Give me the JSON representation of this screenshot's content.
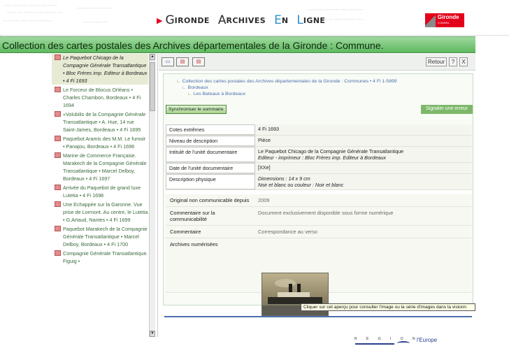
{
  "header": {
    "title_arrow": "▶",
    "title_words": [
      {
        "cap": "G",
        "rest": "IRONDE"
      },
      {
        "cap": "A",
        "rest": "RCHIVES"
      },
      {
        "cap": "E",
        "rest": "N"
      },
      {
        "cap": "L",
        "rest": "IGNE"
      }
    ],
    "logo_name": "Gironde",
    "logo_sub": "CONSEIL GÉNÉRAL"
  },
  "page_title": "Collection des cartes postales des Archives départementales de la Gironde : Commune.",
  "tree": {
    "items": [
      {
        "label": "Le Paquebot Chicago de la Compagnie Générale Transatlantique • Bloc Frères imp. Editeur à Bordeaux • 4 Fi 1693",
        "active": true
      },
      {
        "label": "Le Forceur de Blocus Orléans • Charles Chambon, Bordeaux • 4 Fi 1694",
        "active": false
      },
      {
        "label": "«Volubilis de la Compagnie Générale Transatlantique • A. Hue, 14 rue Saint-James, Bordeaux • 4 Fi 1695",
        "active": false
      },
      {
        "label": "Paquebot Aramis des M.M. Le fumoir • Panajou, Bordeaux • 4 Fi 1696",
        "active": false
      },
      {
        "label": "Marine de Commerce Française. Marakech de la Compagnie Générale Transatlantique • Marcel Delboy, Bordeaux • 4 Fi 1697",
        "active": false
      },
      {
        "label": "Arrivée du Paquebot de grand luxe Lutetia • 4 Fi 1698",
        "active": false
      },
      {
        "label": "Une Echappée sur la Garonne. Vue prise de Lormont. Au centre, le Lutetia • G.Artaud, Nantes • 4 Fi 1699",
        "active": false
      },
      {
        "label": "Paquebot Marakech de la Compagnie Générale Transatlantique • Marcel Delboy, Bordeaux • 4 Fi 1700",
        "active": false
      },
      {
        "label": "Compagnie Générale Transatlantique. Figuig •",
        "active": false
      }
    ]
  },
  "toolbar": {
    "retour_label": "Retour",
    "help_label": "?",
    "close_label": "X"
  },
  "breadcrumb": {
    "level1": "Collection des cartes postales des Archives départementales de la Gironde : Communes • 4 Fi 1-5899",
    "level2": "Bordeaux",
    "level3": "Les Bateaux à Bordeaux"
  },
  "actions": {
    "sync_label": "Synchroniser le sommaire",
    "error_label": "Signaler une erreur"
  },
  "description": {
    "rows": [
      {
        "label": "Cotes extrêmes",
        "value": "4 Fi 1693"
      },
      {
        "label": "Niveau de description",
        "value": "Pièce"
      },
      {
        "label": "Intitulé de l'unité documentaire",
        "value": "Le Paquebot Chicago de la Compagnie Générale Transatlantique",
        "value2": "Editeur - imprimeur : Bloc Frères imp. Editeur à Bordeaux"
      },
      {
        "label": "Date de l'unité documentaire",
        "value": "[XXe]"
      },
      {
        "label": "Description physique",
        "value": "Dimensions : 14 x 9 cm",
        "value2": "Noir et blanc ou couleur : Noir et blanc"
      }
    ],
    "notes": [
      {
        "label": "Original non communicable depuis",
        "value": "2009"
      },
      {
        "label": "Commentaire sur la communicabilité",
        "value": "Document exclusivement disponible sous forme numérique"
      },
      {
        "label": "Commentaire",
        "value": "Correspondance au verso"
      },
      {
        "label": "Archives numérisées",
        "value": ""
      }
    ]
  },
  "tooltip": "Cliquer sur cet aperçu pour consulter l'image ou la série d'images dans la visionn",
  "footer": {
    "region_text": "R É G I O N",
    "europe_text": "l'Europe"
  }
}
